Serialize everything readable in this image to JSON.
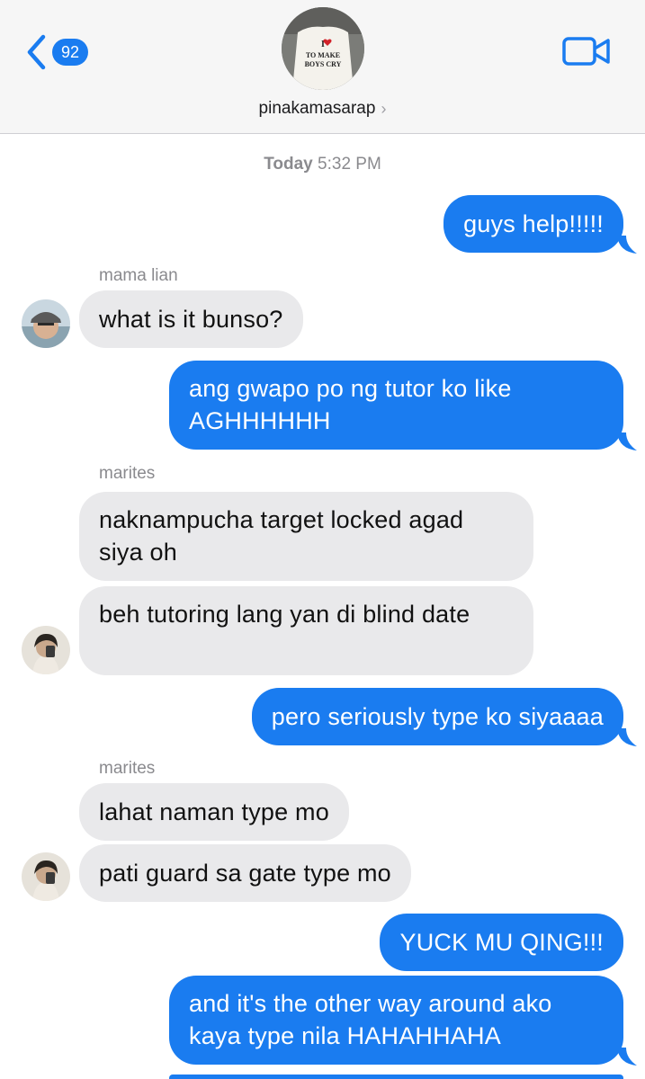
{
  "header": {
    "back_count": "92",
    "group_name": "pinakamasarap",
    "group_chevron": "›",
    "avatar_text_line1": "I",
    "avatar_text_line2": "TO MAKE",
    "avatar_text_line3": "BOYS CRY"
  },
  "timestamp": {
    "day": "Today",
    "time": "5:32 PM"
  },
  "messages": [
    {
      "dir": "out",
      "text": "guys help!!!!!"
    },
    {
      "dir": "in",
      "sender": "mama lian",
      "text": "what is it bunso?"
    },
    {
      "dir": "out",
      "text": "ang gwapo po ng tutor ko like AGHHHHHH"
    },
    {
      "dir": "in",
      "sender": "marites",
      "text": "naknampucha target locked agad siya oh"
    },
    {
      "dir": "in",
      "text": "beh tutoring lang yan di blind date"
    },
    {
      "dir": "out",
      "text": "pero seriously type ko siyaaaa"
    },
    {
      "dir": "in",
      "sender": "marites",
      "text": "lahat naman type mo"
    },
    {
      "dir": "in",
      "text": "pati guard sa gate type mo"
    },
    {
      "dir": "out",
      "text": "YUCK MU QING!!!"
    },
    {
      "dir": "out",
      "text": "and it's the other way around ako kaya type nila HAHAHHAHA"
    }
  ],
  "colors": {
    "outgoing": "#1a7cf0",
    "incoming": "#e9e9eb",
    "accent": "#1a7cf0"
  },
  "icons": {
    "back": "chevron-left-icon",
    "video": "video-camera-icon"
  }
}
